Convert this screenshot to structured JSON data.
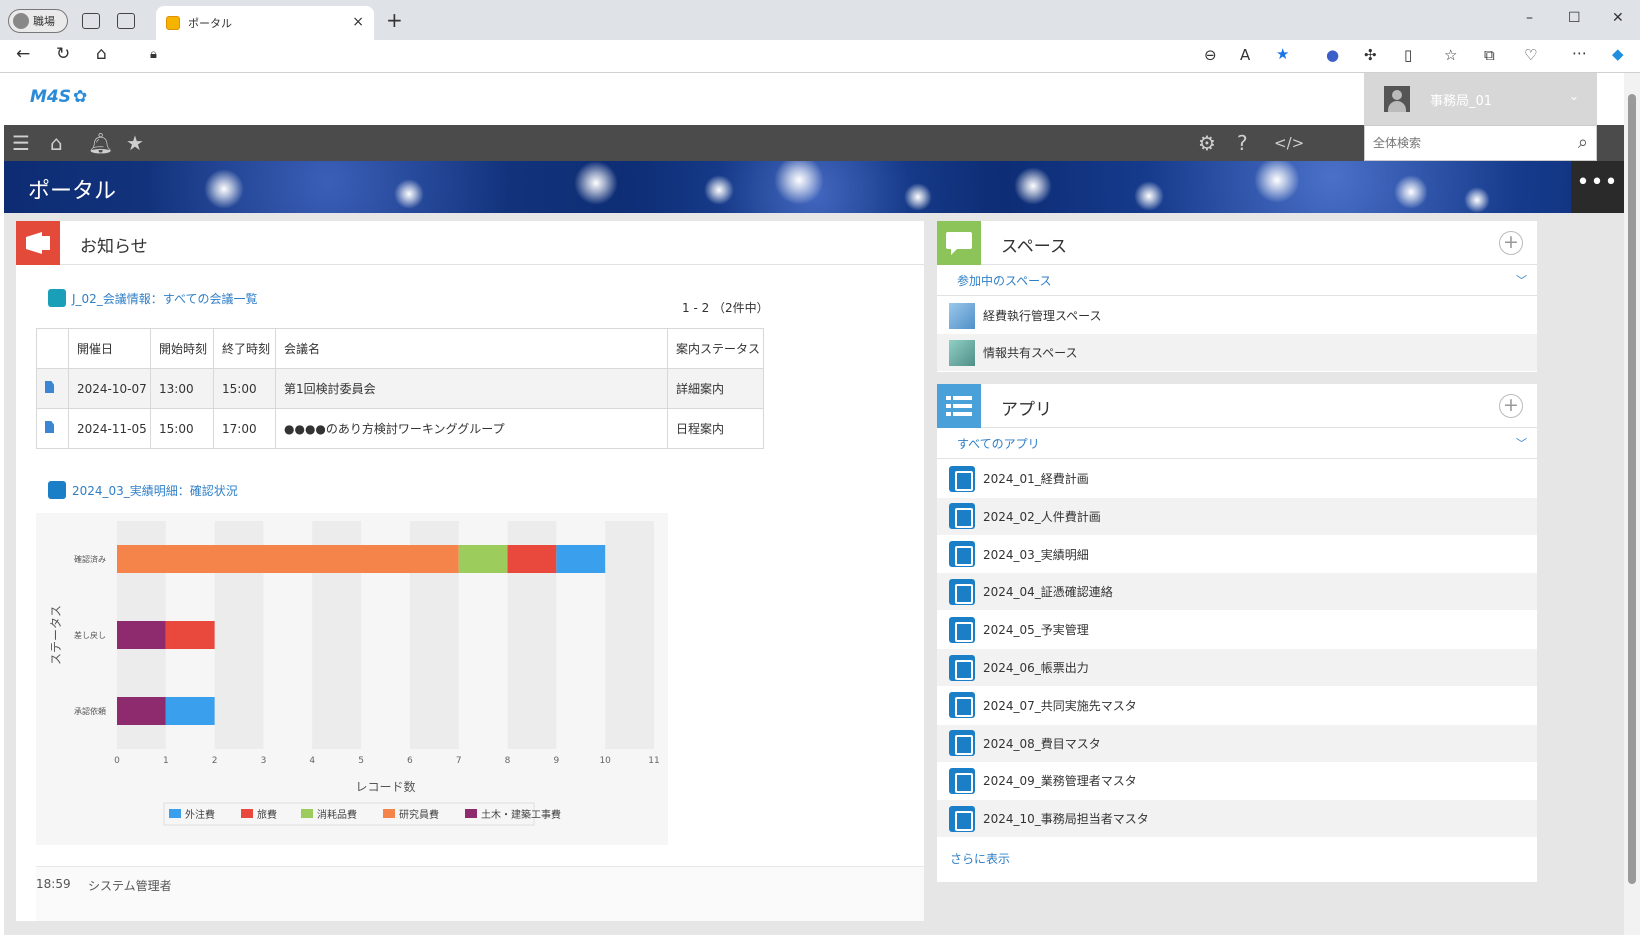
{
  "browser": {
    "profile_label": "職場",
    "tab_title": "ポータル",
    "tab_close": "×",
    "new_tab": "+",
    "win_minimize": "–",
    "win_maximize": "☐",
    "win_close": "✕"
  },
  "app": {
    "logo_text": "M4S",
    "user_name": "事務局_01",
    "search_placeholder": "全体検索",
    "banner_title": "ポータル",
    "banner_menu": "•••"
  },
  "notice": {
    "title": "お知らせ",
    "meeting_link": "J_02_会議情報：すべての会議一覧",
    "paging": "1 - 2 （2件中）",
    "columns": [
      "開催日",
      "開始時刻",
      "終了時刻",
      "会議名",
      "案内ステータス"
    ],
    "rows": [
      {
        "date": "2024-10-07",
        "start": "13:00",
        "end": "15:00",
        "name": "第1回検討委員会",
        "status": "詳細案内"
      },
      {
        "date": "2024-11-05",
        "start": "15:00",
        "end": "17:00",
        "name": "●●●●のあり方検討ワーキンググループ",
        "status": "日程案内"
      }
    ],
    "chart_link": "2024_03_実績明細：確認状況",
    "footer_time": "18:59",
    "footer_user": "システム管理者"
  },
  "chart_data": {
    "type": "bar",
    "orientation": "horizontal",
    "stacked": true,
    "categories": [
      "確認済み",
      "差し戻し",
      "承認依頼"
    ],
    "series": [
      {
        "name": "外注費",
        "color": "#3aa0ee",
        "values": [
          1,
          0,
          1
        ]
      },
      {
        "name": "旅費",
        "color": "#e8493c",
        "values": [
          1,
          1,
          0
        ]
      },
      {
        "name": "消耗品費",
        "color": "#9ccc5c",
        "values": [
          1,
          0,
          0
        ]
      },
      {
        "name": "研究員費",
        "color": "#f5844a",
        "values": [
          7,
          0,
          0
        ]
      },
      {
        "name": "土木・建築工事費",
        "color": "#8e2a6e",
        "values": [
          0,
          1,
          1
        ]
      }
    ],
    "stack_order": [
      "研究員費",
      "消耗品費",
      "旅費",
      "外注費",
      "土木・建築工事費"
    ],
    "xlabel": "レコード数",
    "ylabel": "ステータス",
    "xlim": [
      0,
      11
    ],
    "xticks": [
      "0",
      "1",
      "2",
      "3",
      "4",
      "5",
      "6",
      "7",
      "8",
      "9",
      "10",
      "11"
    ],
    "legend": "bottom",
    "grid": true
  },
  "spaces": {
    "title": "スペース",
    "section": "参加中のスペース",
    "items": [
      {
        "label": "経費執行管理スペース",
        "color": "#6aa5d6"
      },
      {
        "label": "情報共有スペース",
        "color": "#6ab0a8"
      }
    ]
  },
  "apps": {
    "title": "アプリ",
    "section": "すべてのアプリ",
    "items": [
      "2024_01_経費計画",
      "2024_02_人件費計画",
      "2024_03_実績明細",
      "2024_04_証憑確認連絡",
      "2024_05_予実管理",
      "2024_06_帳票出力",
      "2024_07_共同実施先マスタ",
      "2024_08_費目マスタ",
      "2024_09_業務管理者マスタ",
      "2024_10_事務局担当者マスタ"
    ],
    "more": "さらに表示"
  },
  "colors": {
    "toolbar": "#4b4b4b",
    "banner": "#0c2b73",
    "notice_icon": "#e34a3a",
    "space_icon": "#8cc45a",
    "app_icon_header": "#4aa0d8",
    "link": "#2f7fc7"
  }
}
